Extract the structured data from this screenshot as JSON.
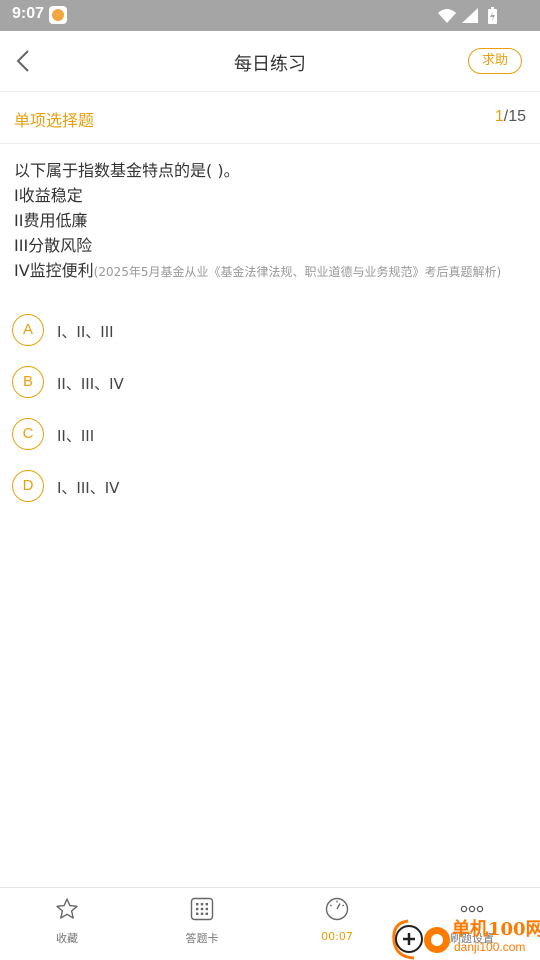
{
  "status_bar": {
    "time": "9:07"
  },
  "header": {
    "title": "每日练习",
    "help_label": "求助"
  },
  "question_meta": {
    "type": "单项选择题",
    "current": "1",
    "total": "/15"
  },
  "question": {
    "stem": "以下属于指数基金特点的是( )。",
    "items": [
      "I收益稳定",
      "II费用低廉",
      "III分散风险",
      "IV监控便利"
    ],
    "source": "(2025年5月基金从业《基金法律法规、职业道德与业务规范》考后真题解析)"
  },
  "options": [
    {
      "letter": "A",
      "text": "I、II、III"
    },
    {
      "letter": "B",
      "text": "II、III、IV"
    },
    {
      "letter": "C",
      "text": "II、III"
    },
    {
      "letter": "D",
      "text": "I、III、IV"
    }
  ],
  "bottom_bar": {
    "favorite_label": "收藏",
    "answer_card_label": "答题卡",
    "timer_label": "00:07",
    "settings_label": "刷题设置"
  },
  "watermark": {
    "name": "单机100网",
    "url": "danji100.com"
  },
  "colors": {
    "accent": "#e8a010",
    "status_bar": "#a5a5a5",
    "watermark": "#ff7a00"
  }
}
